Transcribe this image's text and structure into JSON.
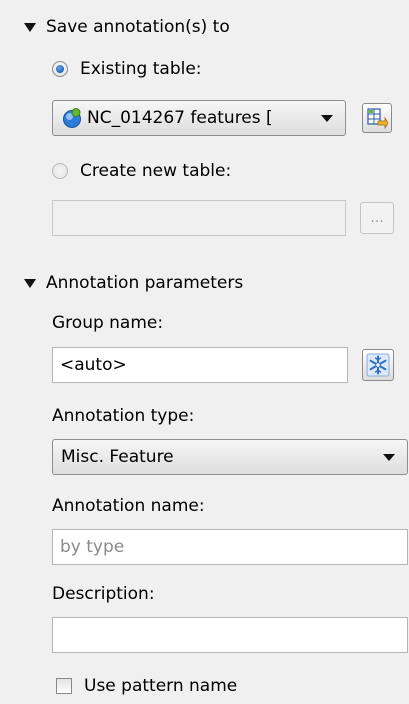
{
  "save_section": {
    "title": "Save annotation(s) to",
    "existing_table": {
      "label": "Existing table:",
      "checked": true
    },
    "table_combo": {
      "value": "NC_014267 features ["
    },
    "create_new_table": {
      "label": "Create new table:",
      "checked": false
    },
    "new_table_path": {
      "value": ""
    },
    "browse_button": {
      "label": "..."
    }
  },
  "annotation_section": {
    "title": "Annotation parameters",
    "group_name": {
      "label": "Group name:",
      "value": "<auto>"
    },
    "annotation_type": {
      "label": "Annotation type:",
      "value": "Misc. Feature"
    },
    "annotation_name": {
      "label": "Annotation name:",
      "placeholder": "by type"
    },
    "description": {
      "label": "Description:",
      "value": ""
    },
    "use_pattern_name": {
      "label": "Use pattern name",
      "checked": false
    }
  },
  "colors": {
    "radio_accent": "#1d5fb5",
    "icon_blue": "#2e7bd6",
    "icon_green": "#5fb830"
  },
  "icons": [
    "chevron-down-icon",
    "database-icon",
    "table-import-icon",
    "snowflake-icon",
    "ellipsis-icon"
  ]
}
